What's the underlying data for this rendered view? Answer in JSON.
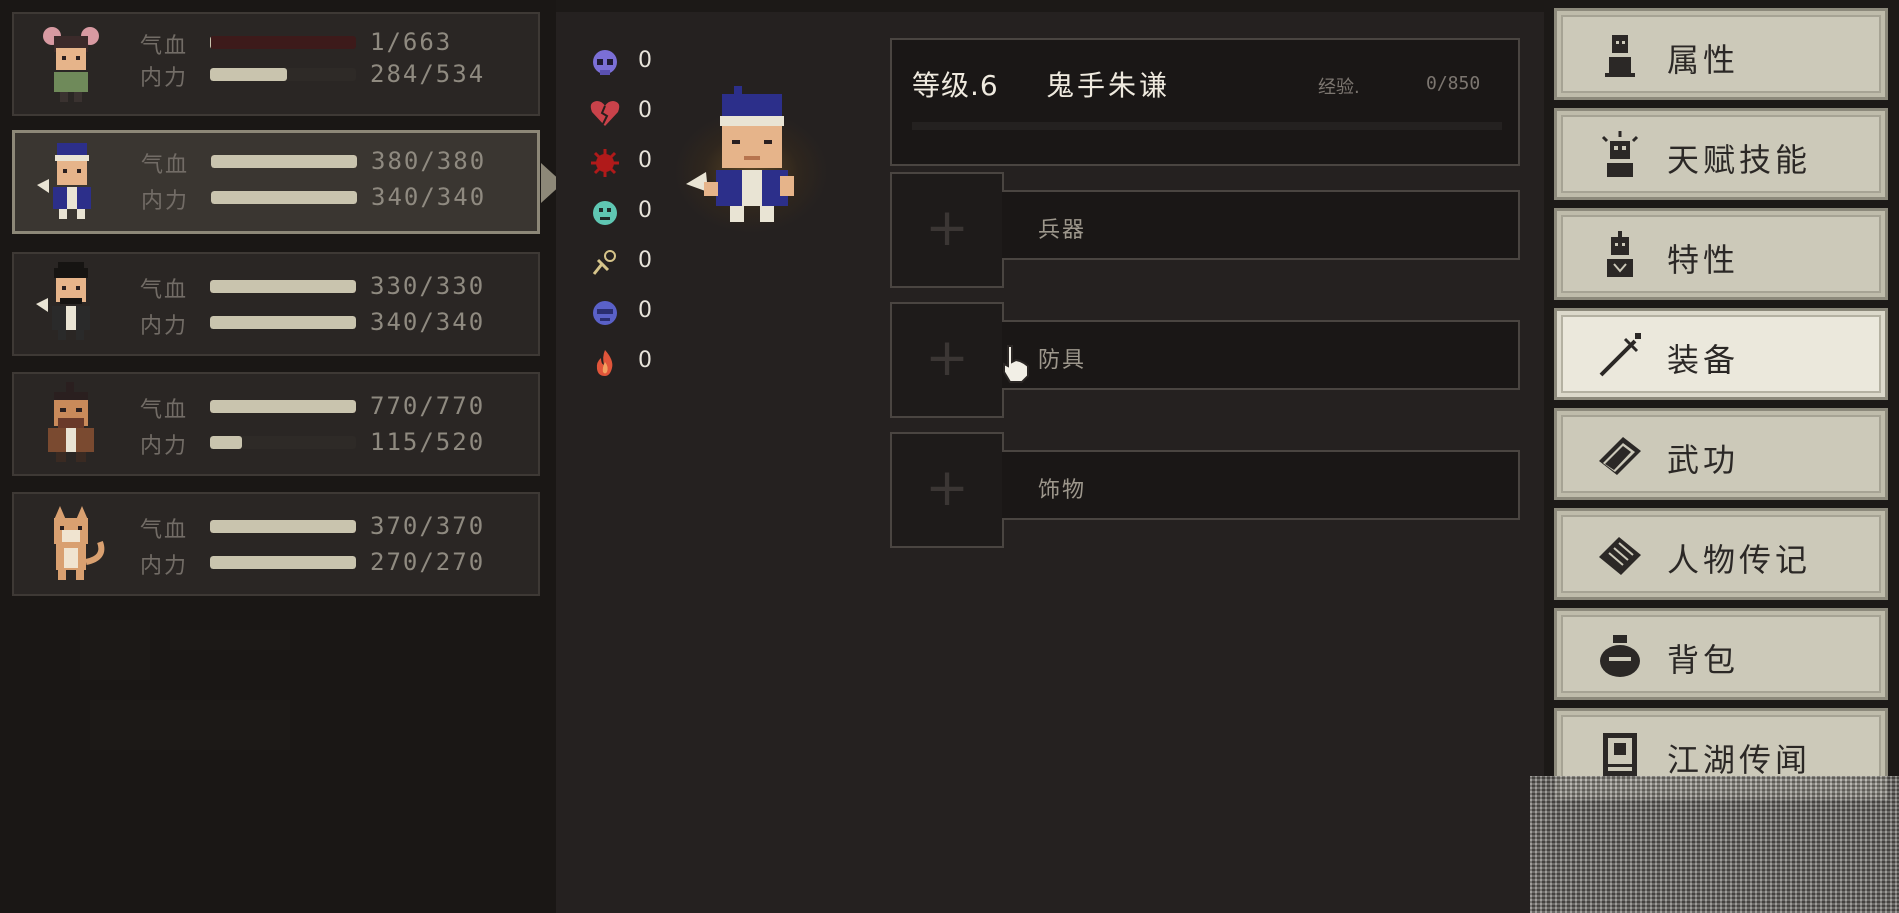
{
  "party": {
    "hp_label": "气血",
    "mp_label": "内力",
    "members": [
      {
        "hp_text": "1/663",
        "hp_ratio": 0.0015,
        "mp_text": "284/534",
        "mp_ratio": 0.53,
        "selected": false
      },
      {
        "hp_text": "380/380",
        "hp_ratio": 1.0,
        "mp_text": "340/340",
        "mp_ratio": 1.0,
        "selected": true
      },
      {
        "hp_text": "330/330",
        "hp_ratio": 1.0,
        "mp_text": "340/340",
        "mp_ratio": 1.0,
        "selected": false
      },
      {
        "hp_text": "770/770",
        "hp_ratio": 1.0,
        "mp_text": "115/520",
        "mp_ratio": 0.22,
        "selected": false
      },
      {
        "hp_text": "370/370",
        "hp_ratio": 1.0,
        "mp_text": "270/270",
        "mp_ratio": 1.0,
        "selected": false
      }
    ]
  },
  "resistances": [
    {
      "icon": "skull-icon",
      "color": "#7b6fd6",
      "value": "0"
    },
    {
      "icon": "broken-heart-icon",
      "color": "#c9424a",
      "value": "0"
    },
    {
      "icon": "red-burst-icon",
      "color": "#b01a1a",
      "value": "0"
    },
    {
      "icon": "teal-face-icon",
      "color": "#5fc7b3",
      "value": "0"
    },
    {
      "icon": "dizzy-icon",
      "color": "#d6c48a",
      "value": "0"
    },
    {
      "icon": "blue-face-icon",
      "color": "#5a61c8",
      "value": "0"
    },
    {
      "icon": "fire-icon",
      "color": "#e0553a",
      "value": "0"
    }
  ],
  "character": {
    "level_text": "等级.6",
    "name": "鬼手朱谦",
    "exp_label": "经验.",
    "exp_value": "0/850"
  },
  "equipment": {
    "slot_icon": "+",
    "slots": [
      {
        "label": "兵器"
      },
      {
        "label": "防具"
      },
      {
        "label": "饰物"
      }
    ]
  },
  "menu": {
    "items": [
      {
        "label": "属性",
        "icon": "person-icon",
        "active": false
      },
      {
        "label": "天赋技能",
        "icon": "talent-icon",
        "active": false
      },
      {
        "label": "特性",
        "icon": "trait-icon",
        "active": false
      },
      {
        "label": "装备",
        "icon": "sword-icon",
        "active": true
      },
      {
        "label": "武功",
        "icon": "book-icon",
        "active": false
      },
      {
        "label": "人物传记",
        "icon": "scroll-icon",
        "active": false
      },
      {
        "label": "背包",
        "icon": "bag-icon",
        "active": false
      },
      {
        "label": "江湖传闻",
        "icon": "notice-icon",
        "active": false
      }
    ]
  },
  "colors": {
    "hp_fill": "#c9c4ae",
    "hp_empty": "#3d1a1a",
    "menu_bg": "#ccc9b9",
    "menu_active_bg": "#ebe8dc"
  }
}
